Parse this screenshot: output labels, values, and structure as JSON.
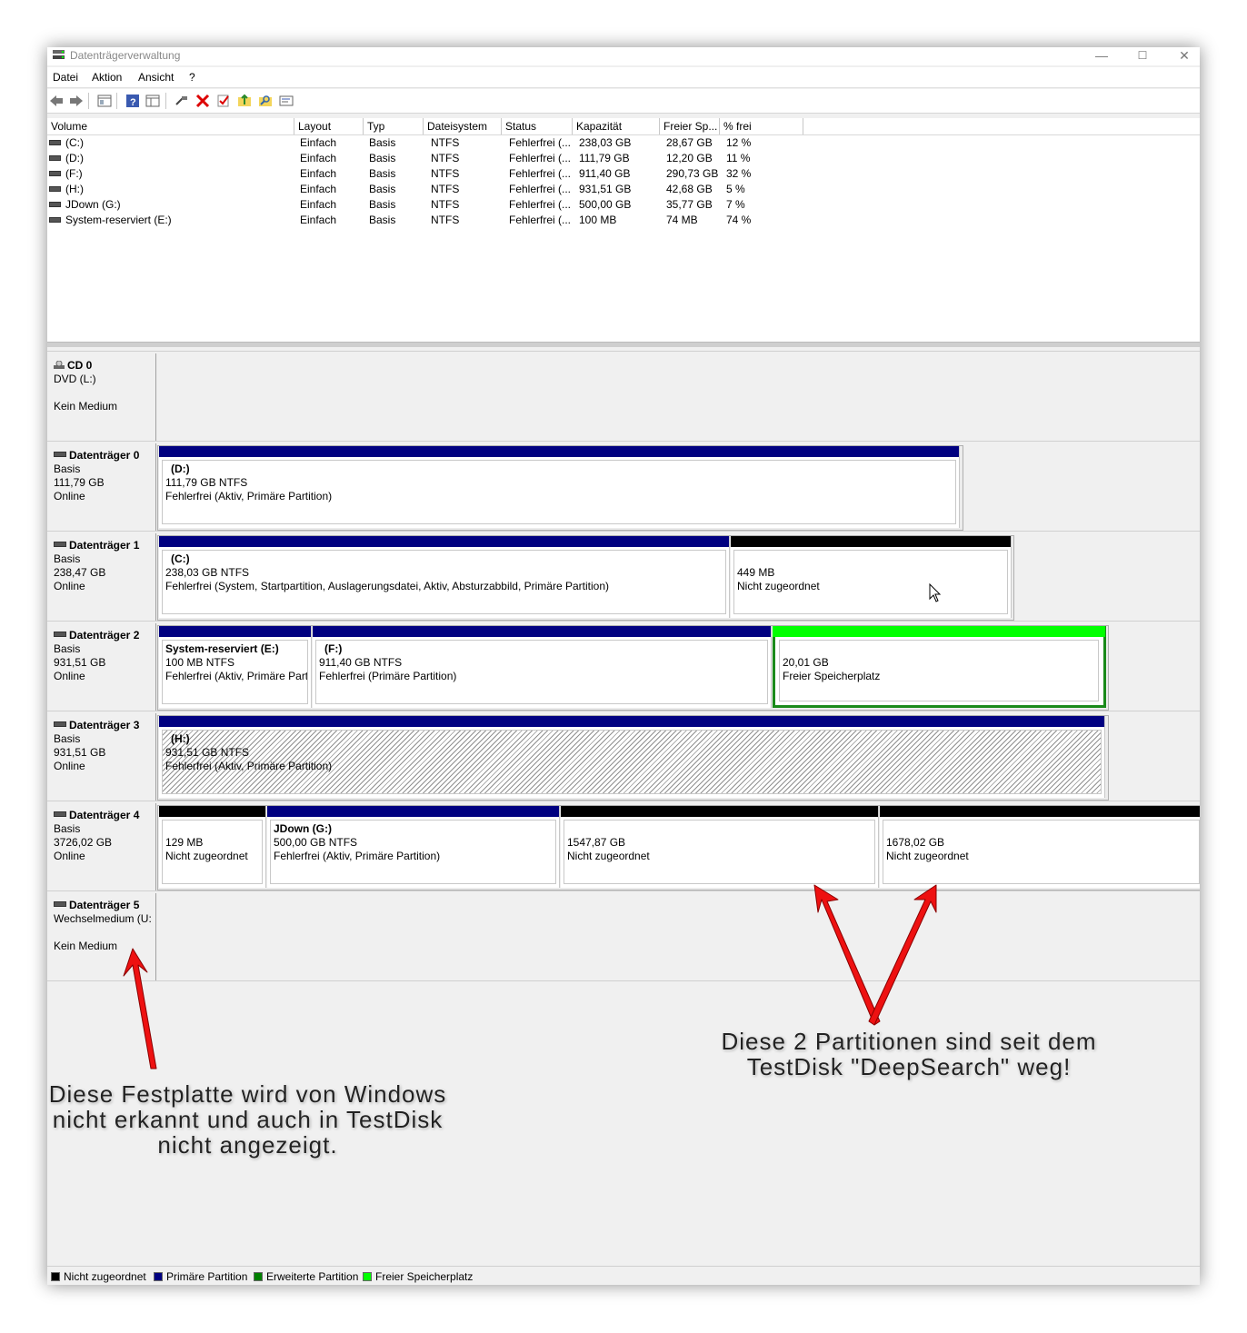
{
  "window": {
    "title": "Datenträgerverwaltung",
    "minimize": "—",
    "maximize": "☐",
    "close": "✕"
  },
  "menu": [
    "Datei",
    "Aktion",
    "Ansicht",
    "?"
  ],
  "toolbar": [
    "back-icon",
    "forward-icon",
    "list-view-icon",
    "help-icon",
    "properties-view-icon",
    "connect-icon",
    "delete-icon",
    "check-icon",
    "folder-up-icon",
    "search-folder-icon",
    "settings-view-icon"
  ],
  "volume_table": {
    "columns": [
      "Volume",
      "Layout",
      "Typ",
      "Dateisystem",
      "Status",
      "Kapazität",
      "Freier Sp...",
      "% frei"
    ],
    "rows": [
      [
        "(C:)",
        "Einfach",
        "Basis",
        "NTFS",
        "Fehlerfrei (...",
        "238,03 GB",
        "28,67 GB",
        "12 %"
      ],
      [
        "(D:)",
        "Einfach",
        "Basis",
        "NTFS",
        "Fehlerfrei (...",
        "111,79 GB",
        "12,20 GB",
        "11 %"
      ],
      [
        "(F:)",
        "Einfach",
        "Basis",
        "NTFS",
        "Fehlerfrei (...",
        "911,40 GB",
        "290,73 GB",
        "32 %"
      ],
      [
        "(H:)",
        "Einfach",
        "Basis",
        "NTFS",
        "Fehlerfrei (...",
        "931,51 GB",
        "42,68 GB",
        "5 %"
      ],
      [
        "JDown (G:)",
        "Einfach",
        "Basis",
        "NTFS",
        "Fehlerfrei (...",
        "500,00 GB",
        "35,77 GB",
        "7 %"
      ],
      [
        "System-reserviert (E:)",
        "Einfach",
        "Basis",
        "NTFS",
        "Fehlerfrei (...",
        "100 MB",
        "74 MB",
        "74 %"
      ]
    ]
  },
  "disks": [
    {
      "name": "CD 0",
      "l1": "DVD (L:)",
      "l2": "",
      "l3": "Kein Medium"
    },
    {
      "name": "Datenträger 0",
      "l1": "Basis",
      "l2": "111,79 GB",
      "l3": "Online",
      "parts": [
        {
          "title": "(D:)",
          "size": "111,79 GB NTFS",
          "status": "Fehlerfrei (Aktiv, Primäre Partition)"
        }
      ]
    },
    {
      "name": "Datenträger 1",
      "l1": "Basis",
      "l2": "238,47 GB",
      "l3": "Online",
      "parts": [
        {
          "title": "(C:)",
          "size": "238,03 GB NTFS",
          "status": "Fehlerfrei (System, Startpartition, Auslagerungsdatei, Aktiv, Absturzabbild, Primäre Partition)"
        },
        {
          "title": "",
          "size": "449 MB",
          "status": "Nicht zugeordnet"
        }
      ]
    },
    {
      "name": "Datenträger 2",
      "l1": "Basis",
      "l2": "931,51 GB",
      "l3": "Online",
      "parts": [
        {
          "title": "System-reserviert  (E:)",
          "size": "100 MB NTFS",
          "status": "Fehlerfrei (Aktiv, Primäre Part"
        },
        {
          "title": "(F:)",
          "size": "911,40 GB NTFS",
          "status": "Fehlerfrei (Primäre Partition)"
        },
        {
          "title": "",
          "size": "20,01 GB",
          "status": "Freier Speicherplatz"
        }
      ]
    },
    {
      "name": "Datenträger 3",
      "l1": "Basis",
      "l2": "931,51 GB",
      "l3": "Online",
      "parts": [
        {
          "title": "(H:)",
          "size": "931,51 GB NTFS",
          "status": "Fehlerfrei (Aktiv, Primäre Partition)"
        }
      ]
    },
    {
      "name": "Datenträger 4",
      "l1": "Basis",
      "l2": "3726,02 GB",
      "l3": "Online",
      "parts": [
        {
          "title": "",
          "size": "129 MB",
          "status": "Nicht zugeordnet"
        },
        {
          "title": "JDown  (G:)",
          "size": "500,00 GB NTFS",
          "status": "Fehlerfrei (Aktiv, Primäre Partition)"
        },
        {
          "title": "",
          "size": "1547,87 GB",
          "status": "Nicht zugeordnet"
        },
        {
          "title": "",
          "size": "1678,02 GB",
          "status": "Nicht zugeordnet"
        }
      ]
    },
    {
      "name": "Datenträger 5",
      "l1": "Wechselmedium (U:",
      "l2": "",
      "l3": "Kein Medium"
    }
  ],
  "legend": [
    {
      "label": "Nicht zugeordnet",
      "color": "#000000"
    },
    {
      "label": "Primäre Partition",
      "color": "#000080"
    },
    {
      "label": "Erweiterte Partition",
      "color": "#008000"
    },
    {
      "label": "Freier Speicherplatz",
      "color": "#00ff00"
    }
  ],
  "annotations": {
    "right": [
      "Diese 2 Partitionen sind seit dem",
      "TestDisk \"DeepSearch\" weg!"
    ],
    "left": [
      "Diese Festplatte wird von Windows",
      "nicht erkannt und auch in TestDisk",
      "nicht angezeigt."
    ]
  }
}
